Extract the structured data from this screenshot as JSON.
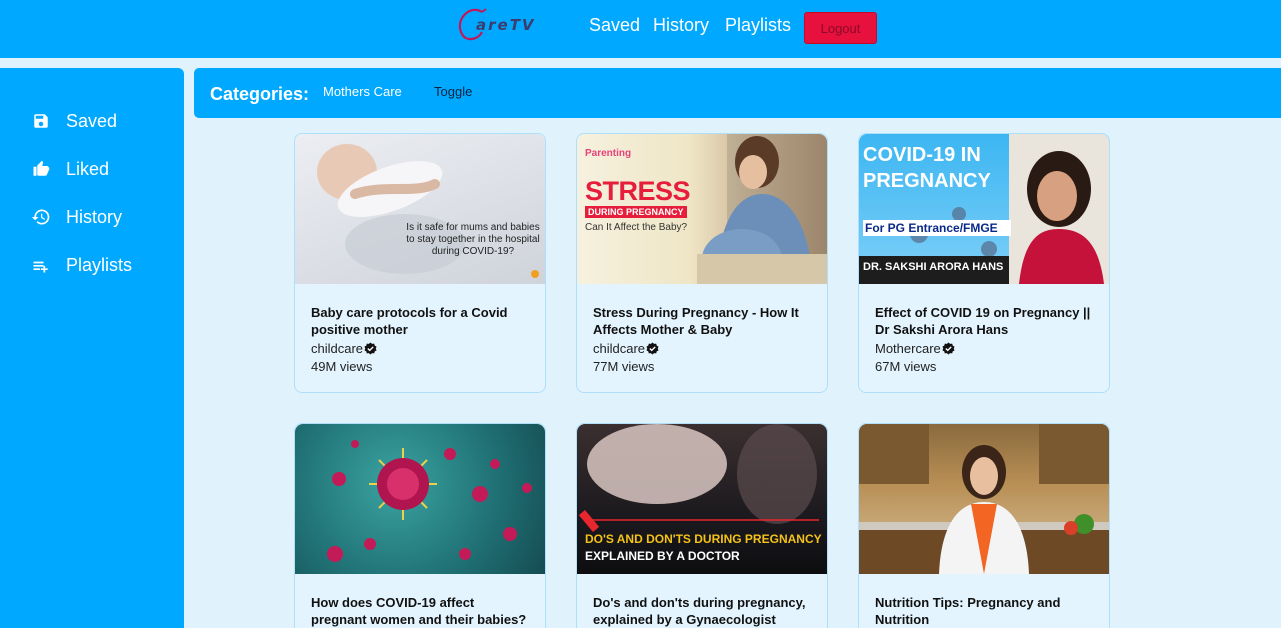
{
  "header": {
    "logo_text": "areTV",
    "nav": [
      "Saved",
      "History",
      "Playlists"
    ],
    "logout_label": "Logout"
  },
  "sidebar": {
    "items": [
      {
        "label": "Saved",
        "icon": "save-icon"
      },
      {
        "label": "Liked",
        "icon": "thumbs-up-icon"
      },
      {
        "label": "History",
        "icon": "history-icon"
      },
      {
        "label": "Playlists",
        "icon": "playlist-add-icon"
      }
    ]
  },
  "categories": {
    "title": "Categories:",
    "chips": [
      "Mothers Care",
      "Toggle"
    ]
  },
  "videos": [
    {
      "title": "Baby care protocols for a Covid positive mother",
      "channel": "childcare",
      "views": "49M views",
      "thumb_text": "Is it safe for mums and babies to stay together in the hospital during COVID-19?"
    },
    {
      "title": "Stress During Pregnancy - How It Affects Mother & Baby",
      "channel": "childcare",
      "views": "77M views",
      "thumb_text": "STRESS",
      "thumb_sub": "DURING PREGNANCY",
      "thumb_sub2": "Can It Affect the Baby?",
      "thumb_brand": "Parenting"
    },
    {
      "title": "Effect of COVID 19 on Pregnancy || Dr Sakshi Arora Hans",
      "channel": "Mothercare",
      "views": "67M views",
      "thumb_text": "COVID-19 IN PREGNANCY",
      "thumb_sub": "For PG Entrance/FMGE",
      "thumb_sub2": "DR. SAKSHI ARORA HANS"
    },
    {
      "title": "How does COVID-19 affect pregnant women and their babies?",
      "channel": "",
      "views": ""
    },
    {
      "title": "Do's and don'ts during pregnancy, explained by a Gynaecologist",
      "channel": "",
      "views": "",
      "thumb_text": "DO'S AND DON'TS DURING PREGNANCY",
      "thumb_sub": "EXPLAINED BY A DOCTOR"
    },
    {
      "title": "Nutrition Tips: Pregnancy and Nutrition",
      "channel": "",
      "views": ""
    }
  ],
  "colors": {
    "primary": "#00a9ff",
    "background": "#e0f3fd",
    "logout": "#e8103c"
  }
}
